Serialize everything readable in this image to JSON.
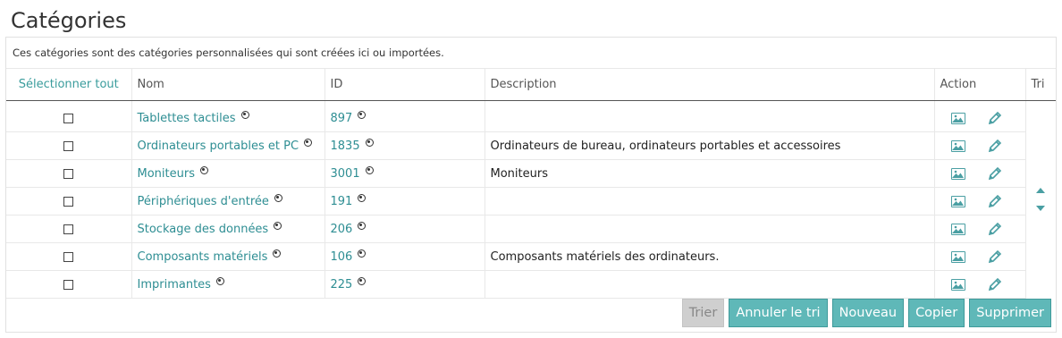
{
  "page": {
    "title": "Catégories"
  },
  "intro": "Ces catégories sont des catégories personnalisées qui sont créées ici ou importées.",
  "table": {
    "headers": {
      "select_all": "Sélectionner tout",
      "name": "Nom",
      "id": "ID",
      "description": "Description",
      "action": "Action",
      "sort": "Tri"
    },
    "rows": [
      {
        "name": "Tablettes tactiles",
        "id": "897",
        "description": ""
      },
      {
        "name": "Ordinateurs portables et PC",
        "id": "1835",
        "description": "Ordinateurs de bureau, ordinateurs portables et accessoires"
      },
      {
        "name": "Moniteurs",
        "id": "3001",
        "description": "Moniteurs"
      },
      {
        "name": "Périphériques d'entrée",
        "id": "191",
        "description": ""
      },
      {
        "name": "Stockage des données",
        "id": "206",
        "description": ""
      },
      {
        "name": "Composants matériels",
        "id": "106",
        "description": "Composants matériels des ordinateurs."
      },
      {
        "name": "Imprimantes",
        "id": "225",
        "description": ""
      }
    ]
  },
  "buttons": {
    "sort": "Trier",
    "cancel_sort": "Annuler le tri",
    "new": "Nouveau",
    "copy": "Copier",
    "delete": "Supprimer"
  },
  "colors": {
    "accent": "#2e8e93",
    "button": "#5fb8b8",
    "disabled": "#cfcfcf"
  },
  "icons": [
    "radio-icon",
    "image-icon",
    "edit-pencil-icon",
    "sort-up-icon",
    "sort-down-icon"
  ]
}
